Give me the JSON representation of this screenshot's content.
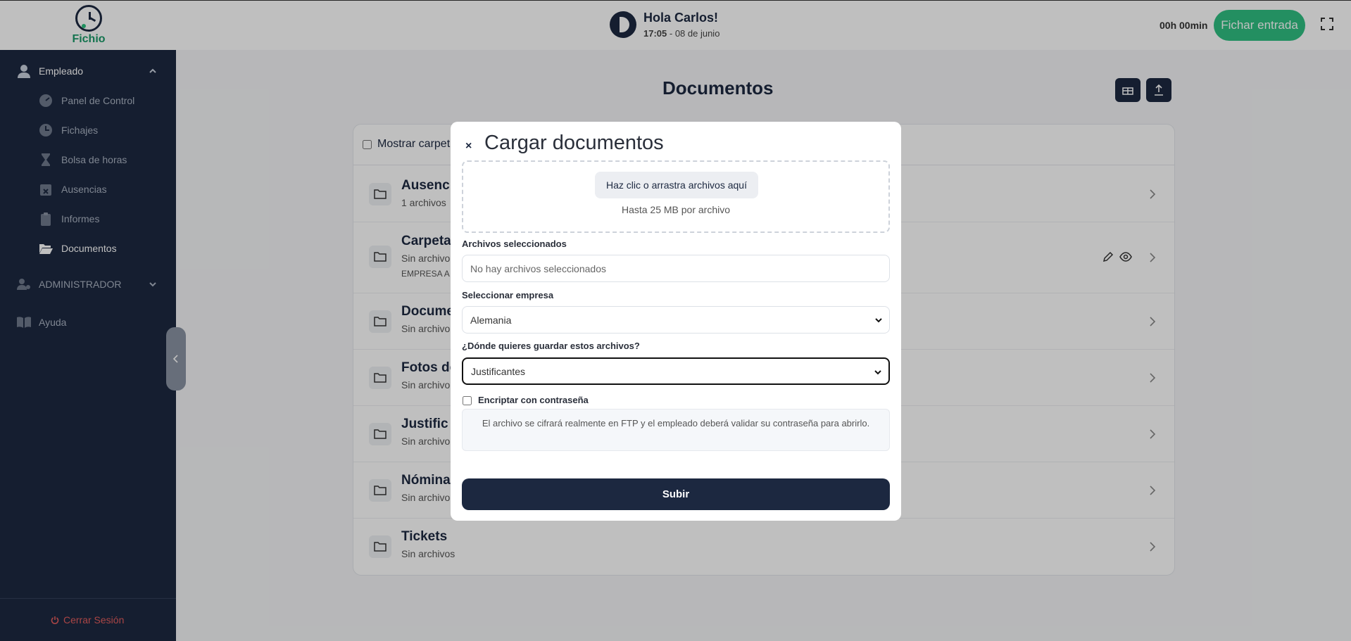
{
  "header": {
    "logo_text": "Fichio",
    "greeting": "Hola Carlos!",
    "time": "17:05",
    "date_sep": " - ",
    "date": "08 de junio",
    "timer": "00h 00min",
    "clock_in_label": "Fichar entrada"
  },
  "sidebar": {
    "employee_section": "Empleado",
    "items": [
      {
        "label": "Panel de Control",
        "icon": "dashboard-icon"
      },
      {
        "label": "Fichajes",
        "icon": "clock-icon"
      },
      {
        "label": "Bolsa de horas",
        "icon": "hourglass-icon"
      },
      {
        "label": "Ausencias",
        "icon": "calendar-x-icon"
      },
      {
        "label": "Informes",
        "icon": "clipboard-icon"
      },
      {
        "label": "Documentos",
        "icon": "folder-open-icon"
      }
    ],
    "admin_section": "ADMINISTRADOR",
    "help": "Ayuda",
    "logout": "Cerrar Sesión"
  },
  "main": {
    "title": "Documentos",
    "show_folders_label": "Mostrar carpet",
    "folders": [
      {
        "title": "Ausenc",
        "sub": "1 archivos",
        "sub2": ""
      },
      {
        "title": "Carpeta",
        "sub": "Sin archivo",
        "sub2": "EMPRESA A"
      },
      {
        "title": "Docume",
        "sub": "Sin archivo",
        "sub2": ""
      },
      {
        "title": "Fotos de",
        "sub": "Sin archivo",
        "sub2": ""
      },
      {
        "title": "Justific",
        "sub": "Sin archivo",
        "sub2": ""
      },
      {
        "title": "Nómina",
        "sub": "Sin archivo",
        "sub2": ""
      },
      {
        "title": "Tickets",
        "sub": "Sin archivos",
        "sub2": ""
      }
    ]
  },
  "modal": {
    "close": "×",
    "title": "Cargar documentos",
    "drop_button": "Haz clic o arrastra archivos aquí",
    "drop_note": "Hasta 25 MB por archivo",
    "selected_label": "Archivos seleccionados",
    "selected_placeholder": "No hay archivos seleccionados",
    "company_label": "Seleccionar empresa",
    "company_value": "Alemania",
    "destination_label": "¿Dónde quieres guardar estos archivos?",
    "destination_value": "Justificantes",
    "encrypt_label": "Encriptar con contraseña",
    "encrypt_note": "El archivo se cifrará realmente en FTP y el empleado deberá validar su contraseña para abrirlo.",
    "submit": "Subir"
  },
  "colors": {
    "navy": "#1c2840",
    "green": "#2fbf82",
    "danger": "#e35d5d"
  }
}
